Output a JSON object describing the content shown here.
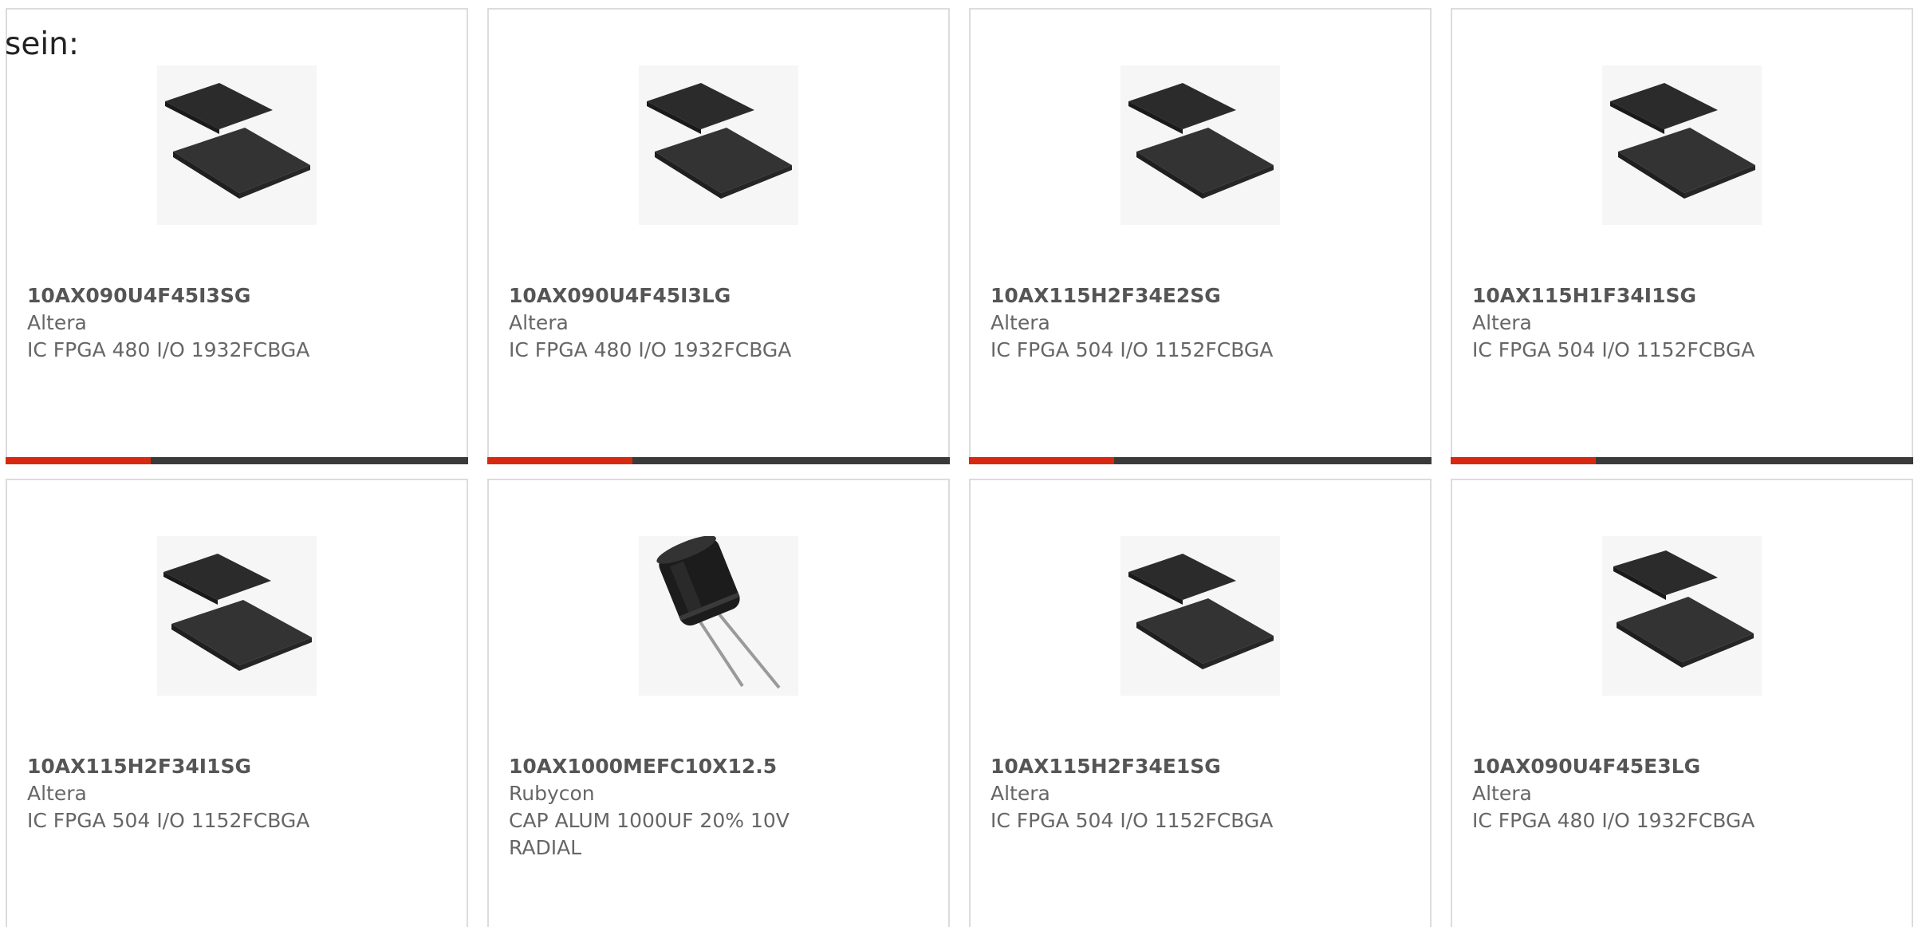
{
  "heading": "sein:",
  "products": [
    {
      "part": "10AX090U4F45I3SG",
      "manufacturer": "Altera",
      "description": "IC FPGA 480 I/O 1932FCBGA",
      "image": "fpga-chip-icon"
    },
    {
      "part": "10AX090U4F45I3LG",
      "manufacturer": "Altera",
      "description": "IC FPGA 480 I/O 1932FCBGA",
      "image": "fpga-chip-icon"
    },
    {
      "part": "10AX115H2F34E2SG",
      "manufacturer": "Altera",
      "description": "IC FPGA 504 I/O 1152FCBGA",
      "image": "fpga-chip-icon"
    },
    {
      "part": "10AX115H1F34I1SG",
      "manufacturer": "Altera",
      "description": "IC FPGA 504 I/O 1152FCBGA",
      "image": "fpga-chip-icon"
    },
    {
      "part": "10AX115H2F34I1SG",
      "manufacturer": "Altera",
      "description": "IC FPGA 504 I/O 1152FCBGA",
      "image": "fpga-chip-icon"
    },
    {
      "part": "10AX1000MEFC10X12.5",
      "manufacturer": "Rubycon",
      "description": "CAP ALUM 1000UF 20% 10V RADIAL",
      "image": "capacitor-icon"
    },
    {
      "part": "10AX115H2F34E1SG",
      "manufacturer": "Altera",
      "description": "IC FPGA 504 I/O 1152FCBGA",
      "image": "fpga-chip-icon"
    },
    {
      "part": "10AX090U4F45E3LG",
      "manufacturer": "Altera",
      "description": "IC FPGA 480 I/O 1932FCBGA",
      "image": "fpga-chip-icon"
    }
  ],
  "colors": {
    "accent": "#d7290f",
    "bar": "#3a3a3a",
    "border": "#dcdcdc",
    "text": "#666666"
  }
}
